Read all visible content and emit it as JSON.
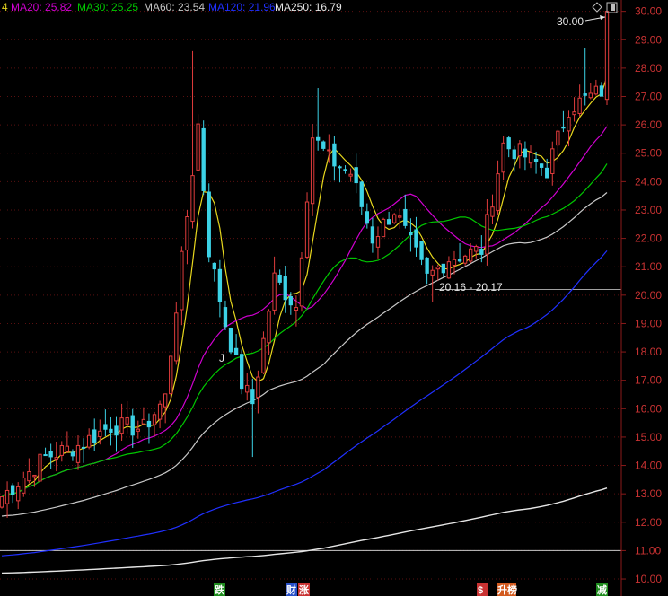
{
  "chart_data": {
    "type": "candlestick",
    "ylim": [
      9.4,
      30.4
    ],
    "y_ticks": [
      "10.00",
      "11.00",
      "12.00",
      "13.00",
      "14.00",
      "15.00",
      "16.00",
      "17.00",
      "18.00",
      "19.00",
      "20.00",
      "21.00",
      "22.00",
      "23.00",
      "24.00",
      "25.00",
      "26.00",
      "27.00",
      "28.00",
      "29.00",
      "30.00"
    ],
    "legend": [
      {
        "prefix": "4",
        "label": "",
        "color": "#e8d81e"
      },
      {
        "prefix": "MA20:",
        "label": "25.82",
        "color": "#d000d0"
      },
      {
        "prefix": "MA30:",
        "label": "25.25",
        "color": "#00c800"
      },
      {
        "prefix": "MA60:",
        "label": "23.54",
        "color": "#c8c8c8"
      },
      {
        "prefix": "MA120:",
        "label": "21.96",
        "color": "#2030ff"
      },
      {
        "prefix": "MA250:",
        "label": "16.79",
        "color": "#e6e6e6"
      }
    ],
    "annotations": {
      "max_label": "30.00",
      "max_value": 30.0,
      "min_label": "20.16 - 20.17",
      "min_value": 20.16,
      "marker_j": "J"
    },
    "horizontal_lines": [
      20.2,
      11.0
    ],
    "event_badges": [
      {
        "text": "跌",
        "color": "#1e8c1e"
      },
      {
        "text": "财",
        "color": "#2850c8"
      },
      {
        "text": "涨",
        "color": "#c83232"
      },
      {
        "text": "$",
        "color": "#c83232"
      },
      {
        "text": "升榜",
        "color": "#d25a1e"
      },
      {
        "text": "减",
        "color": "#1e8c1e"
      }
    ],
    "candles": [],
    "series": []
  }
}
